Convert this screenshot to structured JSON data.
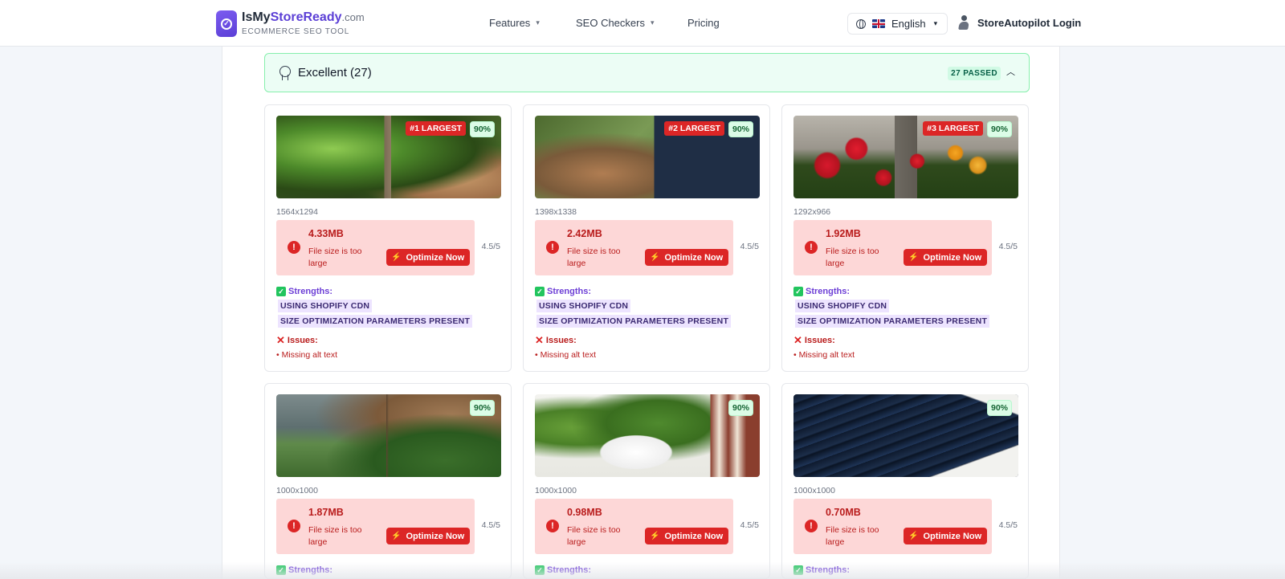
{
  "header": {
    "logo": {
      "part1": "IsMy",
      "part2": "StoreReady",
      "part3": ".com",
      "subtitle": "ECOMMERCE SEO TOOL"
    },
    "nav": [
      {
        "label": "Features",
        "has_dropdown": true
      },
      {
        "label": "SEO Checkers",
        "has_dropdown": true
      },
      {
        "label": "Pricing",
        "has_dropdown": false
      }
    ],
    "language": {
      "label": "English",
      "flag": "uk-flag"
    },
    "login_label": "StoreAutopilot Login"
  },
  "section": {
    "title": "Excellent (27)",
    "passed_badge": "27 PASSED",
    "expanded": true
  },
  "labels": {
    "strengths": "Strengths:",
    "issues": "Issues:",
    "optimize": "Optimize Now",
    "alert_icon": "!",
    "check_icon": "✓",
    "x_icon": "✕",
    "bolt_icon": "⚡",
    "chevron_down": "⌄",
    "chevron_up": "⌃"
  },
  "images": [
    {
      "rank": "#1 LARGEST",
      "score_pct": "90%",
      "dims": "1564x1294",
      "size": "4.33MB",
      "alert": "File size is too large",
      "rating": "4.5/5",
      "strengths": [
        "USING SHOPIFY CDN",
        "SIZE OPTIMIZATION PARAMETERS PRESENT"
      ],
      "issues": [
        "• Missing alt text"
      ]
    },
    {
      "rank": "#2 LARGEST",
      "score_pct": "90%",
      "dims": "1398x1338",
      "size": "2.42MB",
      "alert": "File size is too large",
      "rating": "4.5/5",
      "strengths": [
        "USING SHOPIFY CDN",
        "SIZE OPTIMIZATION PARAMETERS PRESENT"
      ],
      "issues": [
        "• Missing alt text"
      ]
    },
    {
      "rank": "#3 LARGEST",
      "score_pct": "90%",
      "dims": "1292x966",
      "size": "1.92MB",
      "alert": "File size is too large",
      "rating": "4.5/5",
      "strengths": [
        "USING SHOPIFY CDN",
        "SIZE OPTIMIZATION PARAMETERS PRESENT"
      ],
      "issues": [
        "• Missing alt text"
      ]
    },
    {
      "rank": "",
      "score_pct": "90%",
      "dims": "1000x1000",
      "size": "1.87MB",
      "alert": "File size is too large",
      "rating": "4.5/5"
    },
    {
      "rank": "",
      "score_pct": "90%",
      "dims": "1000x1000",
      "size": "0.98MB",
      "alert": "File size is too large",
      "rating": "4.5/5"
    },
    {
      "rank": "",
      "score_pct": "90%",
      "dims": "1000x1000",
      "size": "0.70MB",
      "alert": "File size is too large",
      "rating": "4.5/5"
    }
  ],
  "colors": {
    "brand": "#5b3fd6",
    "danger": "#dc2626",
    "success_bg": "#ecfdf5",
    "success_border": "#86efac",
    "strength_tag_bg": "#ede4ff"
  }
}
